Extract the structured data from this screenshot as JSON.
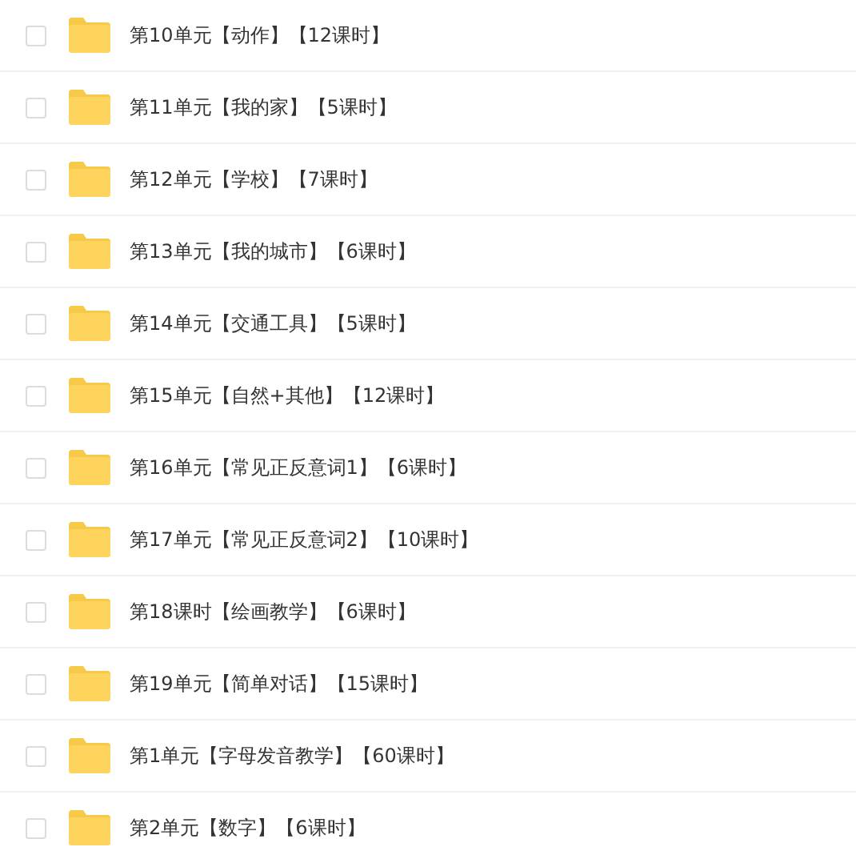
{
  "folders": [
    {
      "name": "第10单元【动作】【12课时】",
      "checked": false
    },
    {
      "name": "第11单元【我的家】【5课时】",
      "checked": false
    },
    {
      "name": "第12单元【学校】【7课时】",
      "checked": false
    },
    {
      "name": "第13单元【我的城市】【6课时】",
      "checked": false
    },
    {
      "name": "第14单元【交通工具】【5课时】",
      "checked": false
    },
    {
      "name": "第15单元【自然+其他】【12课时】",
      "checked": false
    },
    {
      "name": "第16单元【常见正反意词1】【6课时】",
      "checked": false
    },
    {
      "name": "第17单元【常见正反意词2】【10课时】",
      "checked": false
    },
    {
      "name": "第18课时【绘画教学】【6课时】",
      "checked": false
    },
    {
      "name": "第19单元【简单对话】【15课时】",
      "checked": false
    },
    {
      "name": "第1单元【字母发音教学】【60课时】",
      "checked": false
    },
    {
      "name": "第2单元【数字】【6课时】",
      "checked": false
    }
  ]
}
